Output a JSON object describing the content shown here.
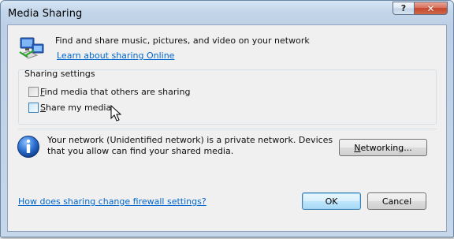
{
  "window": {
    "title": "Media Sharing",
    "help_glyph": "?",
    "close_glyph": "✕"
  },
  "header": {
    "description": "Find and share music, pictures, and video on your network",
    "learn_link": "Learn about sharing Online",
    "icon": "network-media-icon"
  },
  "settings": {
    "group_label": "Sharing settings",
    "find_media": {
      "label_accel": "F",
      "label_rest": "ind media that others are sharing",
      "checked": false
    },
    "share_media": {
      "label_accel": "S",
      "label_rest": "hare my media",
      "checked": false
    }
  },
  "network": {
    "icon": "info-icon",
    "message": "Your network (Unidentified network) is a private network. Devices that you allow can find your shared media.",
    "networking_accel": "N",
    "networking_rest": "etworking..."
  },
  "footer": {
    "firewall_link": "How does sharing change firewall settings?",
    "ok_label": "OK",
    "cancel_label": "Cancel"
  },
  "colors": {
    "link": "#0066cc",
    "close_button": "#c4462e",
    "title_bar": "#c3d6ea"
  }
}
